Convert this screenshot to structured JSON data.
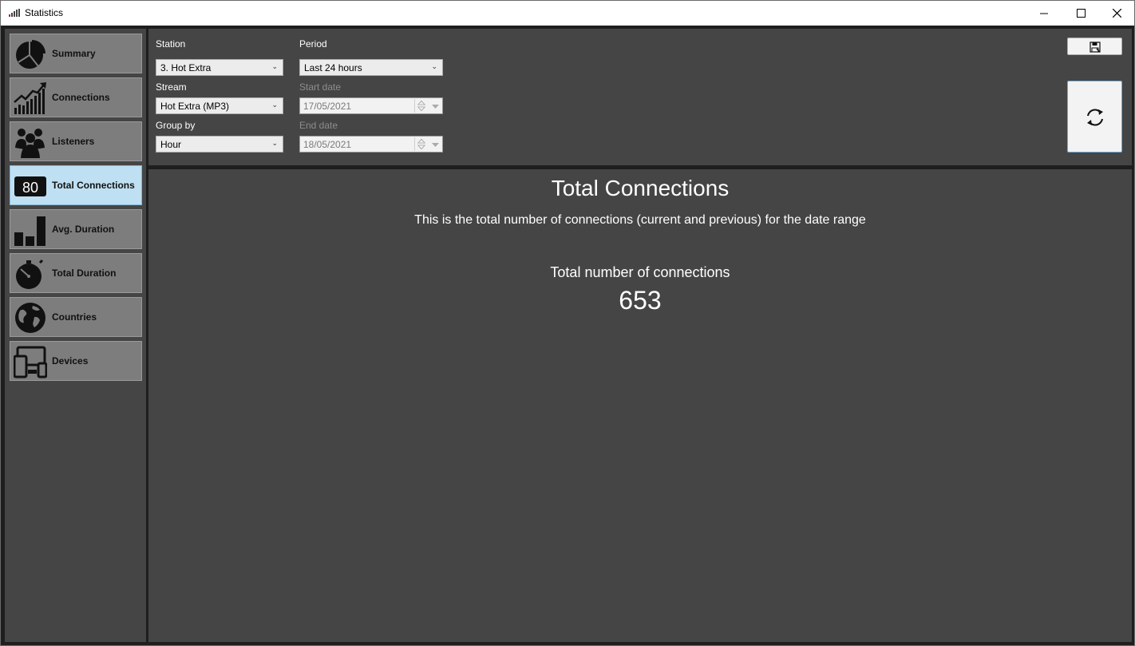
{
  "window": {
    "title": "Statistics",
    "icon": "signal-bars-icon"
  },
  "sidebar": {
    "items": [
      {
        "label": "Summary",
        "icon": "pie-chart-icon",
        "active": false
      },
      {
        "label": "Connections",
        "icon": "trend-chart-icon",
        "active": false
      },
      {
        "label": "Listeners",
        "icon": "people-group-icon",
        "active": false
      },
      {
        "label": "Total Connections",
        "icon": "counter-icon",
        "icon_text": "80",
        "active": true
      },
      {
        "label": "Avg. Duration",
        "icon": "bar-chart-icon",
        "active": false
      },
      {
        "label": "Total Duration",
        "icon": "stopwatch-icon",
        "active": false
      },
      {
        "label": "Countries",
        "icon": "globe-icon",
        "active": false
      },
      {
        "label": "Devices",
        "icon": "devices-icon",
        "active": false
      }
    ]
  },
  "filters": {
    "station_label": "Station",
    "station_value": "3. Hot Extra",
    "stream_label": "Stream",
    "stream_value": "Hot Extra (MP3)",
    "groupby_label": "Group by",
    "groupby_value": "Hour",
    "period_label": "Period",
    "period_value": "Last 24 hours",
    "start_label": "Start date",
    "start_value": "17/05/2021",
    "end_label": "End date",
    "end_value": "18/05/2021"
  },
  "actions": {
    "save_icon": "save-icon",
    "refresh_icon": "refresh-icon"
  },
  "content": {
    "title": "Total Connections",
    "description": "This is the total number of connections (current and previous) for the date range",
    "metric_label": "Total number of connections",
    "metric_value": "653"
  },
  "colors": {
    "panel": "#454545",
    "active_nav": "#bfe0f2",
    "nav": "#7d7d7d"
  }
}
